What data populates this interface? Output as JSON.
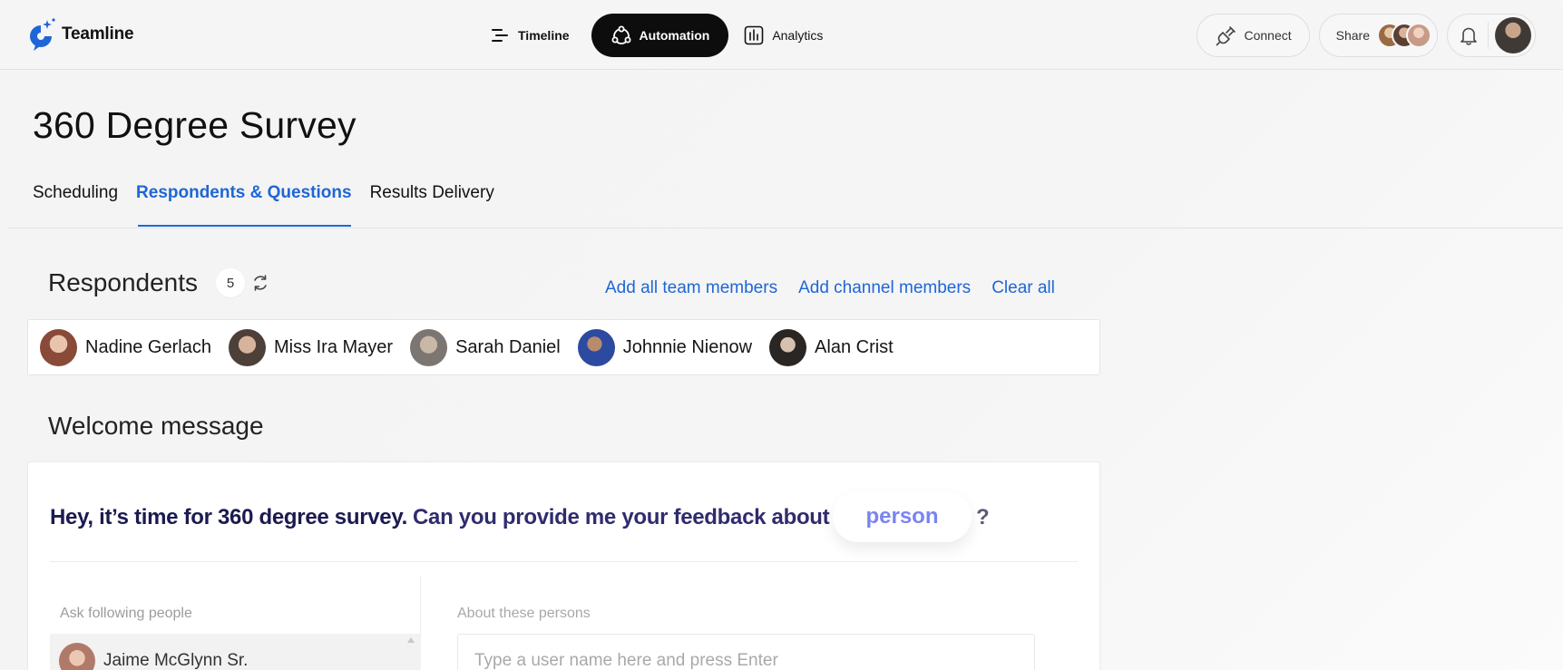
{
  "app": {
    "name": "Teamline"
  },
  "nav": {
    "items": [
      {
        "label": "Timeline",
        "icon": "timeline-icon",
        "active": false
      },
      {
        "label": "Automation",
        "icon": "automation-icon",
        "active": true
      },
      {
        "label": "Analytics",
        "icon": "analytics-icon",
        "active": false
      }
    ]
  },
  "header_actions": {
    "connect_label": "Connect",
    "share_label": "Share"
  },
  "page": {
    "title": "360 Degree Survey",
    "tabs": [
      {
        "label": "Scheduling",
        "active": false
      },
      {
        "label": "Respondents & Questions",
        "active": true
      },
      {
        "label": "Results Delivery",
        "active": false
      }
    ]
  },
  "respondents": {
    "title": "Respondents",
    "count": "5",
    "actions": {
      "add_team": "Add all team members",
      "add_channel": "Add channel members",
      "clear": "Clear all"
    },
    "people": [
      {
        "name": "Nadine Gerlach",
        "avatar_color": "#b07a64"
      },
      {
        "name": "Miss Ira Mayer",
        "avatar_color": "#6b5a4e"
      },
      {
        "name": "Sarah Daniel",
        "avatar_color": "#8a8480"
      },
      {
        "name": "Johnnie Nienow",
        "avatar_color": "#2c4aa0"
      },
      {
        "name": "Alan Crist",
        "avatar_color": "#2a2624"
      }
    ]
  },
  "welcome": {
    "title": "Welcome message",
    "message_lead": "Hey, it’s time for 360 degree survey.",
    "message_rest": "Can you provide me your feedback about",
    "token": "person",
    "suffix": "?",
    "ask_label": "Ask following people",
    "ask_people": [
      {
        "name": "Jaime McGlynn Sr."
      }
    ],
    "about_label": "About these persons",
    "about_placeholder": "Type a user name here and press Enter"
  },
  "colors": {
    "accent": "#1e66d6",
    "nav_active_bg": "#0d0d0d",
    "token_text": "#7a84f0",
    "message_text": "#1b1a50"
  }
}
